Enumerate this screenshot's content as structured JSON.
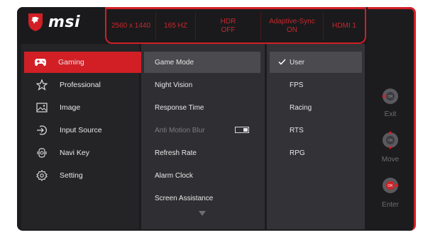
{
  "brand": "msi",
  "status": {
    "resolution": "2560 x 1440",
    "refresh": "165 HZ",
    "hdr_line1": "HDR",
    "hdr_line2": "OFF",
    "sync_line1": "Adaptive-Sync",
    "sync_line2": "ON",
    "input": "HDMI 1"
  },
  "main_menu": [
    {
      "label": "Gaming",
      "icon": "gamepad-icon"
    },
    {
      "label": "Professional",
      "icon": "star-icon"
    },
    {
      "label": "Image",
      "icon": "image-icon"
    },
    {
      "label": "Input Source",
      "icon": "input-source-icon"
    },
    {
      "label": "Navi Key",
      "icon": "navi-key-icon"
    },
    {
      "label": "Setting",
      "icon": "gear-icon"
    }
  ],
  "sub_menu": [
    {
      "label": "Game Mode"
    },
    {
      "label": "Night Vision"
    },
    {
      "label": "Response Time"
    },
    {
      "label": "Anti Motion Blur",
      "toggle": "off"
    },
    {
      "label": "Refresh Rate"
    },
    {
      "label": "Alarm Clock"
    },
    {
      "label": "Screen Assistance"
    }
  ],
  "options": [
    {
      "label": "User",
      "selected": true
    },
    {
      "label": "FPS"
    },
    {
      "label": "Racing"
    },
    {
      "label": "RTS"
    },
    {
      "label": "RPG"
    }
  ],
  "controls": {
    "exit_label": "Exit",
    "move_label": "Move",
    "enter_label": "Enter",
    "ok_text": "OK"
  },
  "colors": {
    "accent": "#d21f26",
    "panel": "#1c1c1e",
    "active_row": "#4a4a4f"
  }
}
